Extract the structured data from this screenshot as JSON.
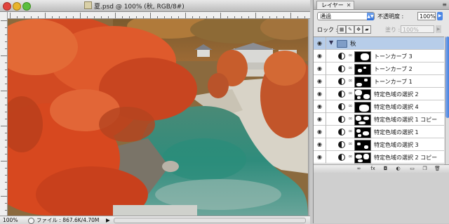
{
  "document": {
    "title": "夏.psd @ 100% (秋, RGB/8#)",
    "zoom": "100%",
    "file_info": "ファイル : 867.6K/4.70M",
    "status_arrow": "▶"
  },
  "layers_panel": {
    "tab_label": "レイヤー",
    "tab_close": "✕",
    "menu_icon": "≡",
    "blend_mode": "通過",
    "opacity_label": "不透明度 :",
    "opacity_value": "100%",
    "lock_label": "ロック :",
    "fill_label": "塗り :",
    "fill_value": "100%",
    "group": {
      "name": "秋",
      "expand_glyph": "▼"
    },
    "layers": [
      {
        "name": "トーンカーブ 3",
        "mask": "curve3"
      },
      {
        "name": "トーンカーブ 2",
        "mask": "curve2"
      },
      {
        "name": "トーンカーブ 1",
        "mask": "curve1"
      },
      {
        "name": "特定色域の選択 2",
        "mask": "sel2"
      },
      {
        "name": "特定色域の選択 4",
        "mask": "sel4"
      },
      {
        "name": "特定色域の選択 1 コピー",
        "mask": "sel1c"
      },
      {
        "name": "特定色域の選択 1",
        "mask": "sel1"
      },
      {
        "name": "特定色域の選択 3",
        "mask": "sel3"
      },
      {
        "name": "特定色域の選択 2 コピー",
        "mask": "sel2c"
      }
    ],
    "bottom_icons": [
      "link-layers-icon",
      "fx-icon",
      "add-mask-icon",
      "adjustment-layer-icon",
      "group-icon",
      "new-layer-icon",
      "trash-icon"
    ],
    "bottom_glyphs": [
      "∞",
      "fx",
      "◘",
      "◐",
      "▭",
      "❐",
      "🗑"
    ]
  }
}
